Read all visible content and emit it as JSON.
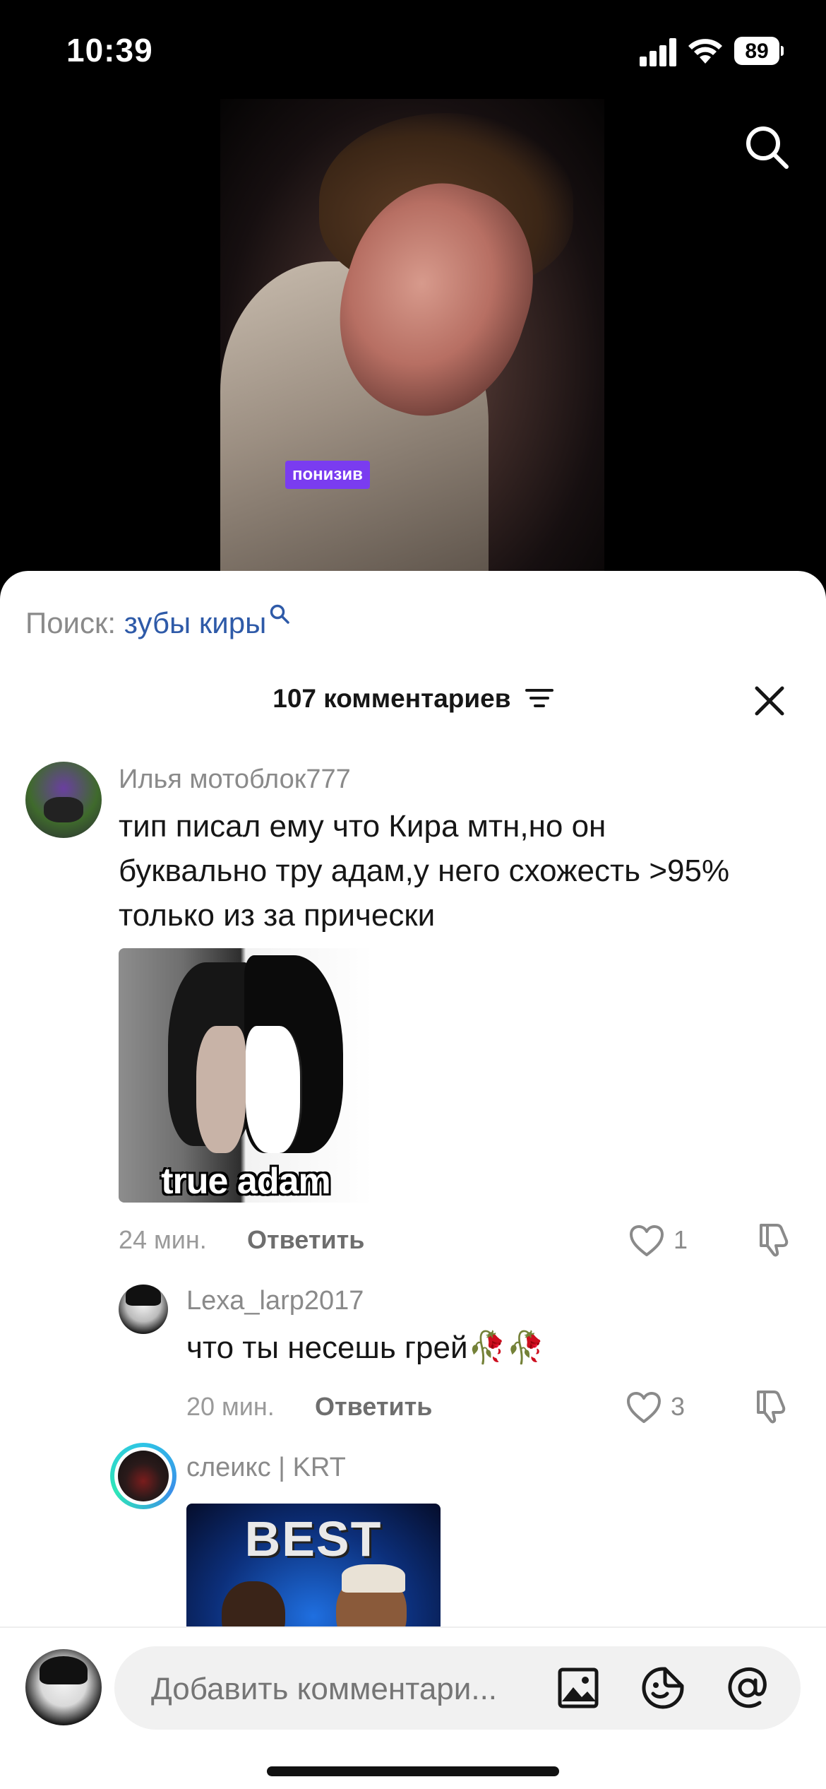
{
  "status_bar": {
    "time": "10:39",
    "battery": "89"
  },
  "video": {
    "caption": "понизив"
  },
  "sheet": {
    "search_prefix": "Поиск:",
    "search_term": "зубы киры",
    "comment_count": "107 комментариев"
  },
  "comments": [
    {
      "username": "Илья мотоблок777",
      "lines": [
        "тип писал ему что Кира мтн,но он",
        "буквально тру адам,у него схожесть >95%",
        "только из за прически"
      ],
      "image_text": "true adam",
      "time": "24 мин.",
      "reply": "Ответить",
      "likes": "1"
    },
    {
      "username": "Lexa_larp2017",
      "text": "что ты несешь грей🥀🥀",
      "time": "20 мин.",
      "reply": "Ответить",
      "likes": "3"
    },
    {
      "username": "слеикс | KRT",
      "image_text": "BEST"
    }
  ],
  "bottom": {
    "placeholder": "Добавить комментари..."
  },
  "colors": {
    "accent_link": "#2e5aa8",
    "caption_bg": "#7a3cf0",
    "story_ring": "#2ec4e6"
  },
  "icons": [
    "search-icon",
    "filter-icon",
    "close-icon",
    "heart-icon",
    "dislike-icon",
    "image-icon",
    "sticker-icon",
    "mention-icon"
  ]
}
